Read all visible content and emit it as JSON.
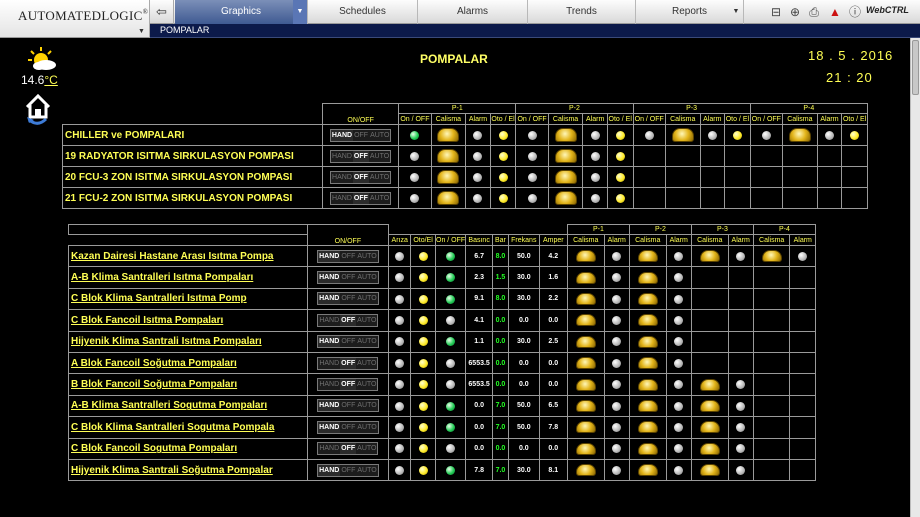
{
  "app": {
    "brand": "AUTOMATEDLOGIC",
    "trademark": "®",
    "webctrl": "WebCTRL"
  },
  "nav": {
    "tabs": [
      {
        "label": "Graphics"
      },
      {
        "label": "Schedules"
      },
      {
        "label": "Alarms"
      },
      {
        "label": "Trends"
      },
      {
        "label": "Reports"
      }
    ]
  },
  "path": "POMPALAR",
  "page": {
    "title": "POMPALAR",
    "date": "18 . 5 . 2016",
    "time": "21 : 20",
    "temperature": "14.6",
    "temperature_unit": "°C"
  },
  "colors": {
    "background": "#000000",
    "label": "#ffff55",
    "accent_tab": "#3f5a92"
  },
  "toggle_labels": {
    "hand": "HAND",
    "off": "OFF",
    "auto": "AUTO"
  },
  "table1": {
    "onoff_header": "ON/OFF",
    "groups": [
      "P-1",
      "P-2",
      "P-3",
      "P-4"
    ],
    "sub_headers": [
      "On / OFF",
      "Calisma",
      "Alarm",
      "Oto / El"
    ],
    "rows": [
      {
        "name": "CHILLER ve POMPALARI",
        "mode": "HAND",
        "pumps": [
          [
            "green",
            "pump",
            "grey",
            "yellow"
          ],
          [
            "grey",
            "pump",
            "grey",
            "yellow"
          ],
          [
            "grey",
            "pump",
            "grey",
            "yellow"
          ],
          [
            "grey",
            "pump",
            "grey",
            "yellow"
          ]
        ]
      },
      {
        "name": "19 RADYATOR ISITMA SIRKULASYON POMPASI",
        "mode": "OFF",
        "pumps": [
          [
            "grey",
            "pump",
            "grey",
            "yellow"
          ],
          [
            "grey",
            "pump",
            "grey",
            "yellow"
          ],
          null,
          null
        ]
      },
      {
        "name": "20 FCU-3 ZON ISITMA SIRKULASYON POMPASI",
        "mode": "OFF",
        "pumps": [
          [
            "grey",
            "pump",
            "grey",
            "yellow"
          ],
          [
            "grey",
            "pump",
            "grey",
            "yellow"
          ],
          null,
          null
        ]
      },
      {
        "name": "21 FCU-2 ZON ISITMA SIRKULASYON POMPASI",
        "mode": "OFF",
        "pumps": [
          [
            "grey",
            "pump",
            "grey",
            "yellow"
          ],
          [
            "grey",
            "pump",
            "grey",
            "yellow"
          ],
          null,
          null
        ]
      }
    ]
  },
  "table2": {
    "onoff_header": "ON/OFF",
    "headers": [
      "Arıza",
      "Oto/El",
      "On / OFF",
      "Basınc",
      "Bar",
      "Frekans",
      "Amper"
    ],
    "groups": [
      "P-1",
      "P-2",
      "P-3",
      "P-4"
    ],
    "sub_headers": [
      "Calisma",
      "Alarm"
    ],
    "rows": [
      {
        "name": "Kazan Dairesi Hastane Arası Isıtma Pompa",
        "mode": "HAND",
        "ariza": "grey",
        "otoel": "yellow",
        "onoff": "green",
        "basinc": "6.7",
        "bar": "8.0",
        "frekans": "50.0",
        "amper": "4.2",
        "pumps": [
          [
            "pump",
            "grey"
          ],
          [
            "pump",
            "grey"
          ],
          [
            "pump",
            "grey"
          ],
          [
            "pump",
            "grey"
          ]
        ]
      },
      {
        "name": "A-B Klima Santralleri Isıtma Pompaları",
        "mode": "HAND",
        "ariza": "grey",
        "otoel": "yellow",
        "onoff": "green",
        "basinc": "2.3",
        "bar": "1.5",
        "frekans": "30.0",
        "amper": "1.6",
        "pumps": [
          [
            "pump",
            "grey"
          ],
          [
            "pump",
            "grey"
          ],
          null,
          null
        ]
      },
      {
        "name": "C Blok Klima Santralleri Isıtma Pomp",
        "mode": "HAND",
        "ariza": "grey",
        "otoel": "yellow",
        "onoff": "green",
        "basinc": "9.1",
        "bar": "8.0",
        "frekans": "30.0",
        "amper": "2.2",
        "pumps": [
          [
            "pump",
            "grey"
          ],
          [
            "pump",
            "grey"
          ],
          null,
          null
        ]
      },
      {
        "name": "C Blok Fancoil Isıtma Pompaları",
        "mode": "OFF",
        "ariza": "grey",
        "otoel": "yellow",
        "onoff": "grey",
        "basinc": "4.1",
        "bar": "0.0",
        "frekans": "0.0",
        "amper": "0.0",
        "pumps": [
          [
            "pump",
            "grey"
          ],
          [
            "pump",
            "grey"
          ],
          null,
          null
        ]
      },
      {
        "name": "Hijyenik Klima Santrali Isıtma Pompaları",
        "mode": "HAND",
        "ariza": "grey",
        "otoel": "yellow",
        "onoff": "green",
        "basinc": "1.1",
        "bar": "0.0",
        "frekans": "30.0",
        "amper": "2.5",
        "pumps": [
          [
            "pump",
            "grey"
          ],
          [
            "pump",
            "grey"
          ],
          null,
          null
        ]
      },
      {
        "name": "A Blok Fancoil Soğutma Pompaları",
        "mode": "OFF",
        "ariza": "grey",
        "otoel": "yellow",
        "onoff": "grey",
        "basinc": "6553.5",
        "bar": "0.0",
        "frekans": "0.0",
        "amper": "0.0",
        "pumps": [
          [
            "pump",
            "grey"
          ],
          [
            "pump",
            "grey"
          ],
          null,
          null
        ]
      },
      {
        "name": "B Blok Fancoil Soğutma Pompaları",
        "mode": "OFF",
        "ariza": "grey",
        "otoel": "yellow",
        "onoff": "grey",
        "basinc": "6553.5",
        "bar": "0.0",
        "frekans": "0.0",
        "amper": "0.0",
        "pumps": [
          [
            "pump",
            "grey"
          ],
          [
            "pump",
            "grey"
          ],
          [
            "pump",
            "grey"
          ],
          null
        ]
      },
      {
        "name": "A-B Klima Santralleri Sogutma Pompaları",
        "mode": "HAND",
        "ariza": "grey",
        "otoel": "yellow",
        "onoff": "green",
        "basinc": "0.0",
        "bar": "7.0",
        "frekans": "50.0",
        "amper": "6.5",
        "pumps": [
          [
            "pump",
            "grey"
          ],
          [
            "pump",
            "grey"
          ],
          [
            "pump",
            "grey"
          ],
          null
        ]
      },
      {
        "name": "C Blok Klima Santralleri Sogutma Pompala",
        "mode": "HAND",
        "ariza": "grey",
        "otoel": "yellow",
        "onoff": "green",
        "basinc": "0.0",
        "bar": "7.0",
        "frekans": "50.0",
        "amper": "7.8",
        "pumps": [
          [
            "pump",
            "grey"
          ],
          [
            "pump",
            "grey"
          ],
          [
            "pump",
            "grey"
          ],
          null
        ]
      },
      {
        "name": "C Blok Fancoil Sogutma Pompaları",
        "mode": "OFF",
        "ariza": "grey",
        "otoel": "yellow",
        "onoff": "grey",
        "basinc": "0.0",
        "bar": "0.0",
        "frekans": "0.0",
        "amper": "0.0",
        "pumps": [
          [
            "pump",
            "grey"
          ],
          [
            "pump",
            "grey"
          ],
          [
            "pump",
            "grey"
          ],
          null
        ]
      },
      {
        "name": "Hijyenik Klima Santrali Soğutma Pompalar",
        "mode": "HAND",
        "ariza": "grey",
        "otoel": "yellow",
        "onoff": "green",
        "basinc": "7.8",
        "bar": "7.0",
        "frekans": "30.0",
        "amper": "8.1",
        "pumps": [
          [
            "pump",
            "grey"
          ],
          [
            "pump",
            "grey"
          ],
          [
            "pump",
            "grey"
          ],
          null
        ]
      }
    ]
  }
}
